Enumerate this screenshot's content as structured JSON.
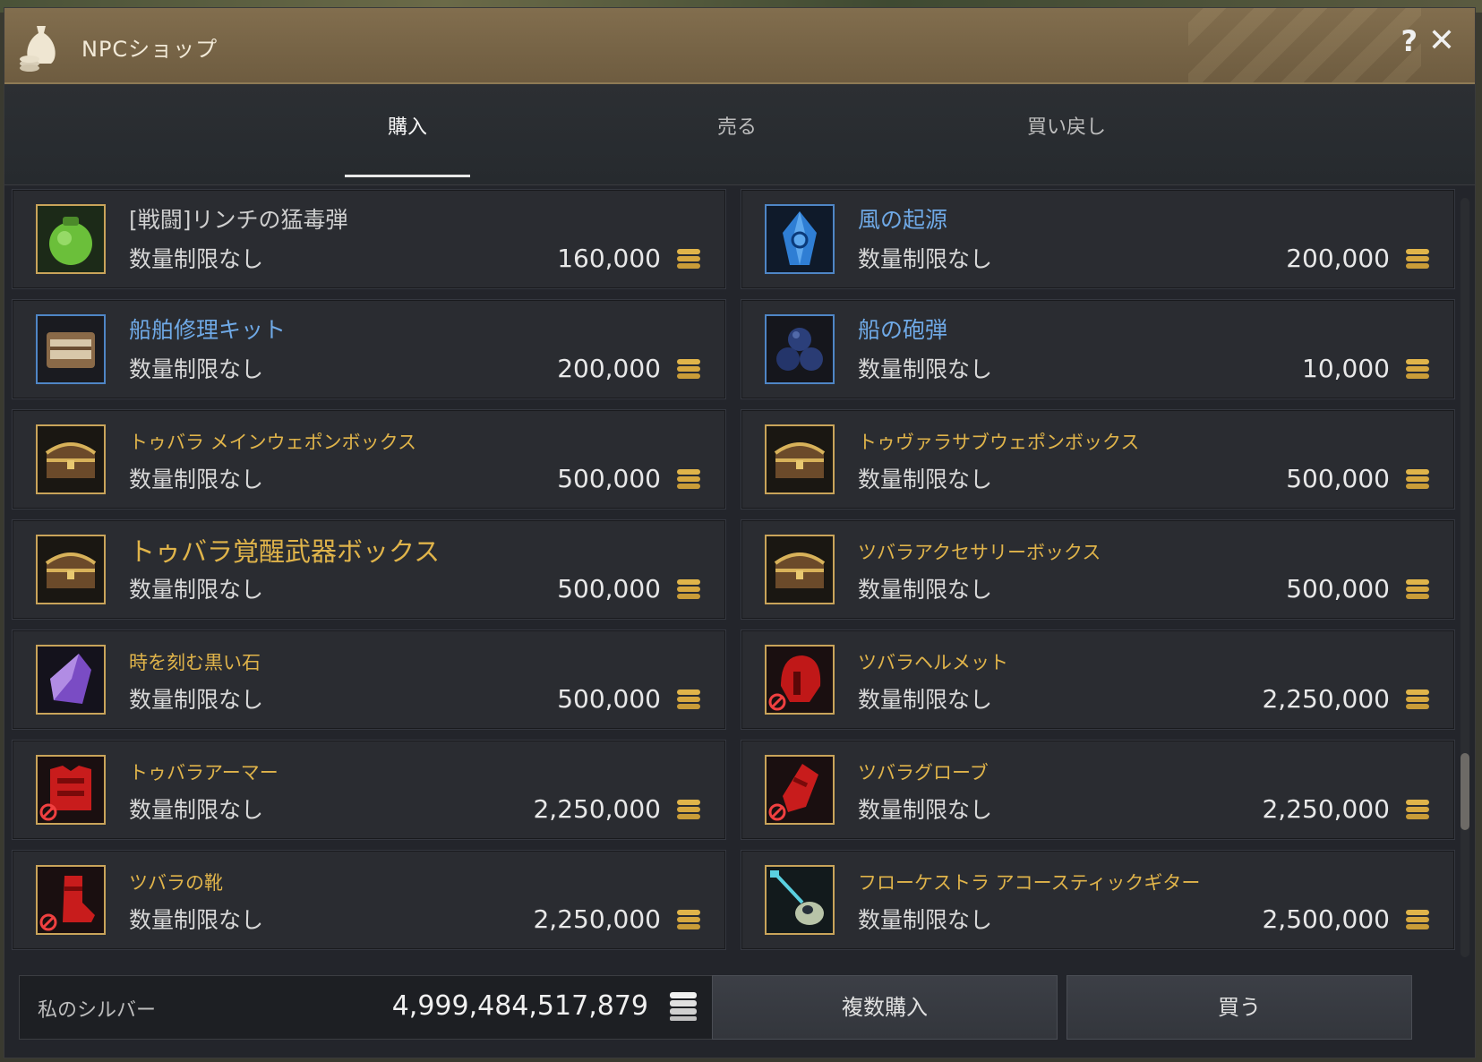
{
  "window": {
    "title": "NPCショップ",
    "help_label": "?",
    "close_label": "✕"
  },
  "tabs": [
    {
      "label": "購入",
      "active": true
    },
    {
      "label": "売る",
      "active": false
    },
    {
      "label": "買い戻し",
      "active": false
    }
  ],
  "items": [
    {
      "name": "[戦闘]リンチの猛毒弾",
      "limit": "数量制限なし",
      "price": "160,000",
      "name_color": "white",
      "icon": "green-potion-icon"
    },
    {
      "name": "風の起源",
      "limit": "数量制限なし",
      "price": "200,000",
      "name_color": "blue",
      "icon": "blue-crystal-icon"
    },
    {
      "name": "船舶修理キット",
      "limit": "数量制限なし",
      "price": "200,000",
      "name_color": "blue",
      "icon": "repair-kit-icon"
    },
    {
      "name": "船の砲弾",
      "limit": "数量制限なし",
      "price": "10,000",
      "name_color": "blue",
      "icon": "cannonballs-icon"
    },
    {
      "name": "トゥバラ メインウェポンボックス",
      "limit": "数量制限なし",
      "price": "500,000",
      "name_color": "yellow",
      "icon": "treasure-chest-icon"
    },
    {
      "name": "トゥヴァラサブウェポンボックス",
      "limit": "数量制限なし",
      "price": "500,000",
      "name_color": "yellow",
      "icon": "treasure-chest-icon"
    },
    {
      "name": "トゥバラ覚醒武器ボックス",
      "limit": "数量制限なし",
      "price": "500,000",
      "name_color": "yellow",
      "icon": "treasure-chest-icon"
    },
    {
      "name": "ツバラアクセサリーボックス",
      "limit": "数量制限なし",
      "price": "500,000",
      "name_color": "yellow",
      "icon": "treasure-chest-icon"
    },
    {
      "name": "時を刻む黒い石",
      "limit": "数量制限なし",
      "price": "500,000",
      "name_color": "yellow",
      "icon": "purple-stone-icon"
    },
    {
      "name": "ツバラヘルメット",
      "limit": "数量制限なし",
      "price": "2,250,000",
      "name_color": "yellow",
      "icon": "red-helmet-icon"
    },
    {
      "name": "トゥバラアーマー",
      "limit": "数量制限なし",
      "price": "2,250,000",
      "name_color": "yellow",
      "icon": "red-armor-icon"
    },
    {
      "name": "ツバラグローブ",
      "limit": "数量制限なし",
      "price": "2,250,000",
      "name_color": "yellow",
      "icon": "red-gloves-icon"
    },
    {
      "name": "ツバラの靴",
      "limit": "数量制限なし",
      "price": "2,250,000",
      "name_color": "yellow",
      "icon": "red-boots-icon"
    },
    {
      "name": "フローケストラ アコースティックギター",
      "limit": "数量制限なし",
      "price": "2,500,000",
      "name_color": "yellow",
      "icon": "guitar-icon"
    }
  ],
  "footer": {
    "silver_label": "私のシルバー",
    "silver_value": "4,999,484,517,879",
    "multi_buy_label": "複数購入",
    "buy_label": "買う"
  },
  "colors": {
    "title_bar": "#826e4e",
    "name_white": "#cfcfcf",
    "name_blue": "#6fa9e6",
    "name_yellow": "#e0b44a",
    "panel": "#2a2c31"
  }
}
